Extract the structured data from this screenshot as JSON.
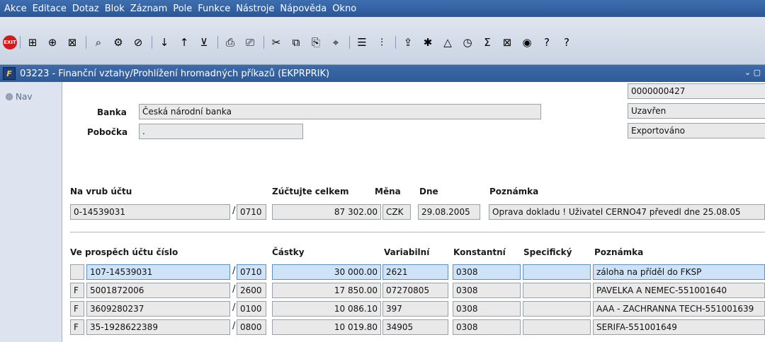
{
  "menu": [
    "Akce",
    "Editace",
    "Dotaz",
    "Blok",
    "Záznam",
    "Pole",
    "Funkce",
    "Nástroje",
    "Nápověda",
    "Okno"
  ],
  "menu_underline": [
    "A",
    "E",
    "D",
    "B",
    "Z",
    "P",
    "F",
    "N",
    "o",
    ""
  ],
  "toolbar": {
    "exit_label": "EXIT",
    "icons": [
      "insert-record-icon",
      "duplicate-record-icon",
      "delete-record-icon",
      "query-icon",
      "execute-query-icon",
      "cancel-query-icon",
      "sort-asc-icon",
      "sort-desc-icon",
      "filter-icon",
      "print-icon",
      "print-preview-icon",
      "cut-icon",
      "copy-icon",
      "paste-icon",
      "find-icon",
      "list-icon",
      "columns-icon",
      "export-icon",
      "tools-icon",
      "chart-icon",
      "calculator-icon",
      "sum-icon",
      "excel-icon",
      "web-icon",
      "help-icon",
      "question-icon"
    ],
    "glyphs": [
      "⊞",
      "⊕",
      "⊠",
      "⌕",
      "⚙",
      "⊘",
      "↓",
      "↑",
      "⊻",
      "⎙",
      "⎚",
      "✂",
      "⧉",
      "⎘",
      "⌖",
      "☰",
      "⫶",
      "⇪",
      "✱",
      "△",
      "◷",
      "Σ",
      "⊠",
      "◉",
      "?",
      "?"
    ]
  },
  "window": {
    "title": "03223 - Finanční vztahy/Prohlížení hromadných příkazů (EKPRPRIK)",
    "icon_letter": "F",
    "controls": "⌄ ▢"
  },
  "nav": {
    "label": "Nav"
  },
  "header": {
    "number": "0000000427",
    "status1": "Uzavřen",
    "status2": "Exportováno",
    "bank_label": "Banka",
    "bank_value": "Česká národní banka",
    "branch_label": "Pobočka",
    "branch_value": "."
  },
  "debit": {
    "labels": {
      "account": "Na vrub účtu",
      "total": "Zúčtujte celkem",
      "currency": "Měna",
      "date": "Dne",
      "note": "Poznámka"
    },
    "account": "0-14539031",
    "bank_code": "0710",
    "total": "87 302.00",
    "currency": "CZK",
    "date": "29.08.2005",
    "note": "Oprava dokladu ! Uživatel CERNO47 převedl dne 25.08.05"
  },
  "items": {
    "headers": {
      "account": "Ve prospěch účtu číslo",
      "amount": "Částky",
      "variable": "Variabilní",
      "constant": "Konstantní",
      "specific": "Specifický",
      "note": "Poznámka"
    },
    "rows": [
      {
        "flag": "",
        "account": "107-14539031",
        "bank": "0710",
        "amount": "30 000.00",
        "vs": "2621",
        "ks": "0308",
        "ss": "",
        "note": "záloha na příděl do FKSP"
      },
      {
        "flag": "F",
        "account": "5001872006",
        "bank": "2600",
        "amount": "17 850.00",
        "vs": "07270805",
        "ks": "0308",
        "ss": "",
        "note": "PAVELKA A NEMEC-551001640"
      },
      {
        "flag": "F",
        "account": "3609280237",
        "bank": "0100",
        "amount": "10 086.10",
        "vs": "397",
        "ks": "0308",
        "ss": "",
        "note": "AAA - ZACHRANNA TECH-551001639"
      },
      {
        "flag": "F",
        "account": "35-1928622389",
        "bank": "0800",
        "amount": "10 019.80",
        "vs": "34905",
        "ks": "0308",
        "ss": "",
        "note": "SERIFA-551001649"
      }
    ]
  },
  "colors": {
    "menubar": "#2f5a98",
    "selected_row": "#cfe3f8",
    "field_bg": "#e9e9e9"
  }
}
